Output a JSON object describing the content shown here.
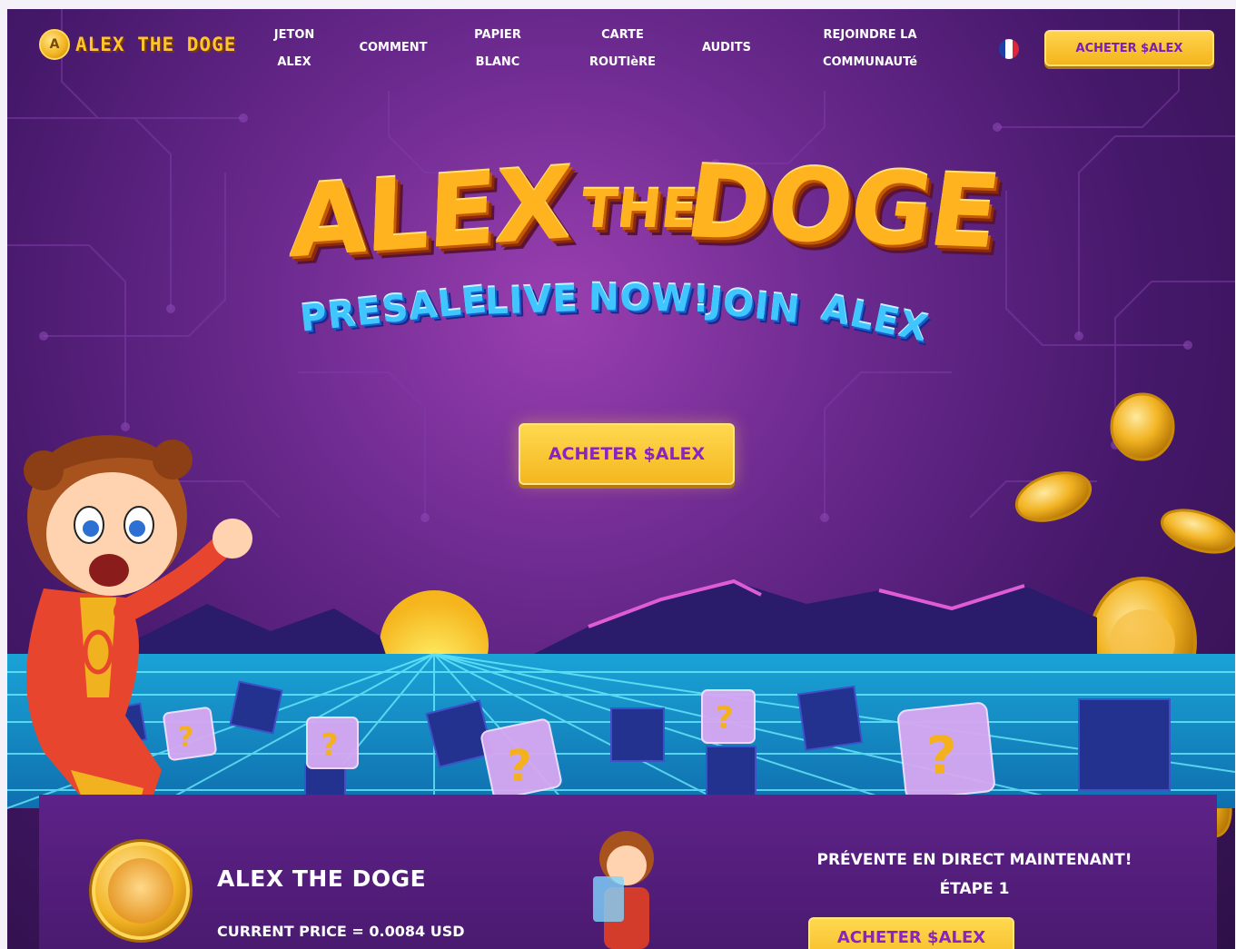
{
  "brand": {
    "name": "ALEX THE DOGE",
    "coin_glyph": "A"
  },
  "nav": {
    "items": [
      {
        "id": "jeton",
        "label": "JETON ALEX"
      },
      {
        "id": "comment",
        "label": "COMMENT"
      },
      {
        "id": "papier",
        "label": "PAPIER BLANC"
      },
      {
        "id": "carte",
        "label": "CARTE ROUTIèRE"
      },
      {
        "id": "audits",
        "label": "AUDITS"
      },
      {
        "id": "communaute",
        "label": "REJOINDRE LA COMMUNAUTé"
      }
    ],
    "language_flag": "flag-fr-icon",
    "cta_label": "ACHETER $ALEX"
  },
  "hero": {
    "title_words": [
      "ALEX",
      "THE",
      "DOGE"
    ],
    "subtitle_words": [
      "PRESALE",
      "LIVE",
      "NOW!",
      "JOIN",
      "ALEX"
    ],
    "cta_label": "ACHETER $ALEX"
  },
  "panel": {
    "name": "ALEX THE DOGE",
    "price": "CURRENT PRICE = 0.0084 USD",
    "presale_line1": "PRÉVENTE EN DIRECT MAINTENANT!",
    "presale_line2": "ÉTAPE 1",
    "cta_label": "ACHETER $ALEX"
  },
  "colors": {
    "accent_yellow": "#f4b71f",
    "cta_text_purple": "#8a22c4",
    "bg_purple": "#45186a",
    "grid_cyan": "#36d8f5",
    "title_orange": "#ffb41f",
    "subtitle_blue": "#3fc6ff"
  },
  "icons": [
    "flag-fr-icon",
    "coin-icon",
    "mystery-box-icon",
    "sun-icon"
  ]
}
